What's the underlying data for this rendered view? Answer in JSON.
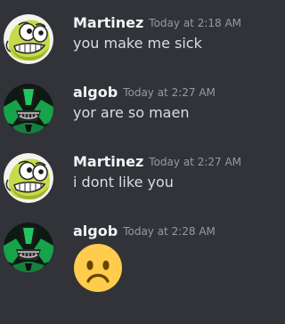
{
  "messages": [
    {
      "author": "Martinez",
      "timestamp": "Today at 2:18 AM",
      "text": "you make me sick",
      "avatar_icon": "green-cartoon-face-icon"
    },
    {
      "author": "algob",
      "timestamp": "Today at 2:27 AM",
      "text": "yor are so maen",
      "avatar_icon": "green-alien-omnitrix-icon"
    },
    {
      "author": "Martinez",
      "timestamp": "Today at 2:27 AM",
      "text": "i dont like you",
      "avatar_icon": "green-cartoon-face-icon"
    },
    {
      "author": "algob",
      "timestamp": "Today at 2:28 AM",
      "emoji": "frowning-face-emoji",
      "avatar_icon": "green-alien-omnitrix-icon"
    }
  ],
  "colors": {
    "background": "#313338",
    "username": "#f2f3f5",
    "timestamp": "#949ba4",
    "message_text": "#dbdee1",
    "emoji_face": "#ffcc4d"
  }
}
